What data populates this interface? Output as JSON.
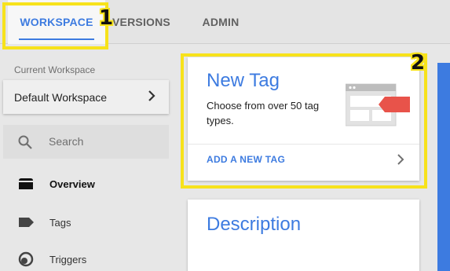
{
  "tabs": [
    {
      "label": "WORKSPACE",
      "active": true
    },
    {
      "label": "VERSIONS",
      "active": false
    },
    {
      "label": "ADMIN",
      "active": false
    }
  ],
  "annotations": {
    "one": "1",
    "two": "2"
  },
  "sidebar": {
    "current_workspace_label": "Current Workspace",
    "workspace_name": "Default Workspace",
    "search_placeholder": "Search",
    "items": [
      {
        "label": "Overview",
        "icon": "folder-icon",
        "active": true
      },
      {
        "label": "Tags",
        "icon": "tag-icon",
        "active": false
      },
      {
        "label": "Triggers",
        "icon": "trigger-icon",
        "active": false
      }
    ]
  },
  "new_tag_card": {
    "title": "New Tag",
    "description": "Choose from over 50 tag types.",
    "link": "ADD A NEW TAG"
  },
  "description_card": {
    "title": "Description"
  },
  "colors": {
    "accent": "#3d7be0",
    "highlight": "#f7e21b",
    "tag_red": "#e8534a"
  }
}
